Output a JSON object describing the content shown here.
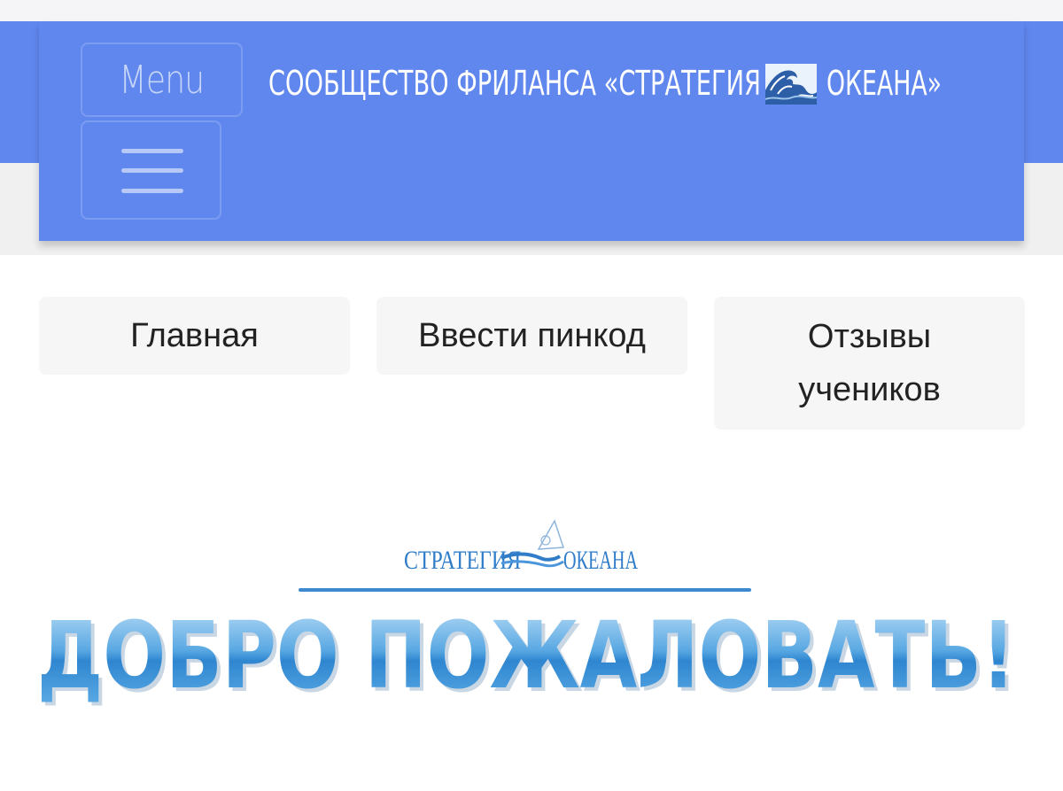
{
  "header": {
    "menu_label": "Menu",
    "title_before": "СООБЩЕСТВО ФРИЛАНСА «СТРАТЕГИЯ",
    "title_after": "ОКЕАНА»",
    "title_icon": "wave-emoji-icon"
  },
  "nav": {
    "items": [
      {
        "label": "Главная"
      },
      {
        "label": "Ввести пинкод"
      },
      {
        "label": "Отзывы учеников"
      }
    ]
  },
  "logo": {
    "word_left": "СТРАТЕГИЯ",
    "word_right": "ОКЕАНА"
  },
  "banner": {
    "text": "ДОБРО ПОЖАЛОВАТЬ!"
  },
  "colors": {
    "header_bg": "#6087ee",
    "tile_bg": "#f6f6f6",
    "brand_blue": "#2f7cc8",
    "banner_blue": "#4a98d8"
  }
}
